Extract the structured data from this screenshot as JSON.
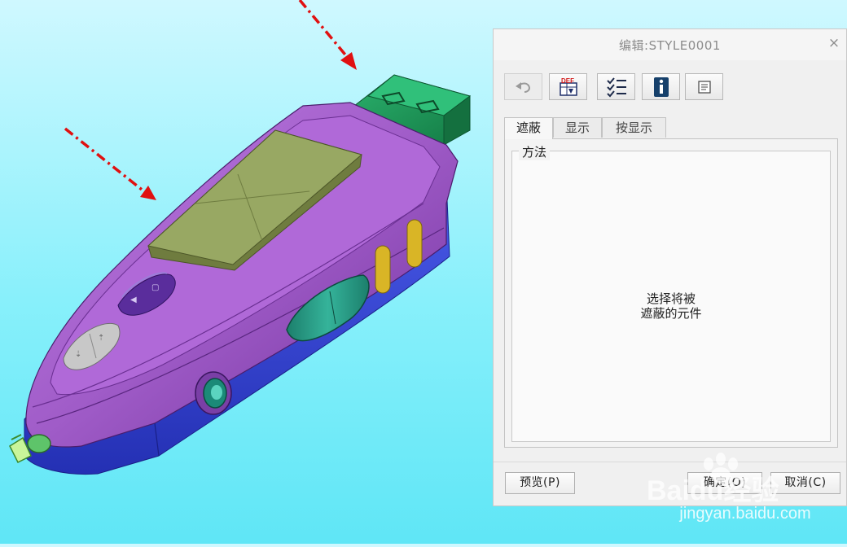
{
  "dialog": {
    "title": "编辑:STYLE0001",
    "close_glyph": "×",
    "toolbar": [
      {
        "name": "undo-button",
        "icon": "undo-icon",
        "enabled": false
      },
      {
        "name": "def-button",
        "icon": "def-layer-icon",
        "label": "DEF"
      },
      {
        "name": "checklist-button",
        "icon": "checklist-icon"
      },
      {
        "name": "info-button",
        "icon": "info-icon"
      },
      {
        "name": "properties-button",
        "icon": "properties-icon"
      }
    ],
    "tabs": [
      {
        "label": "遮蔽",
        "active": true
      },
      {
        "label": "显示",
        "active": false
      },
      {
        "label": "按显示",
        "active": false
      }
    ],
    "group_label": "方法",
    "prompt_line1": "选择将被",
    "prompt_line2": "遮蔽的元件",
    "preview_label": "预览(P)",
    "ok_label": "确定(O)",
    "cancel_label": "取消(C)"
  },
  "watermark": {
    "brand": "Baidu经验",
    "url": "jingyan.baidu.com"
  },
  "colors": {
    "background_top": "#cff8ff",
    "background_bottom": "#5fe6f6",
    "body_purple": "#9b59c4",
    "base_blue": "#3948d8",
    "usb_green": "#1f9a5c",
    "lcd_olive": "#8f9e57",
    "arrow_red": "#e01010"
  }
}
